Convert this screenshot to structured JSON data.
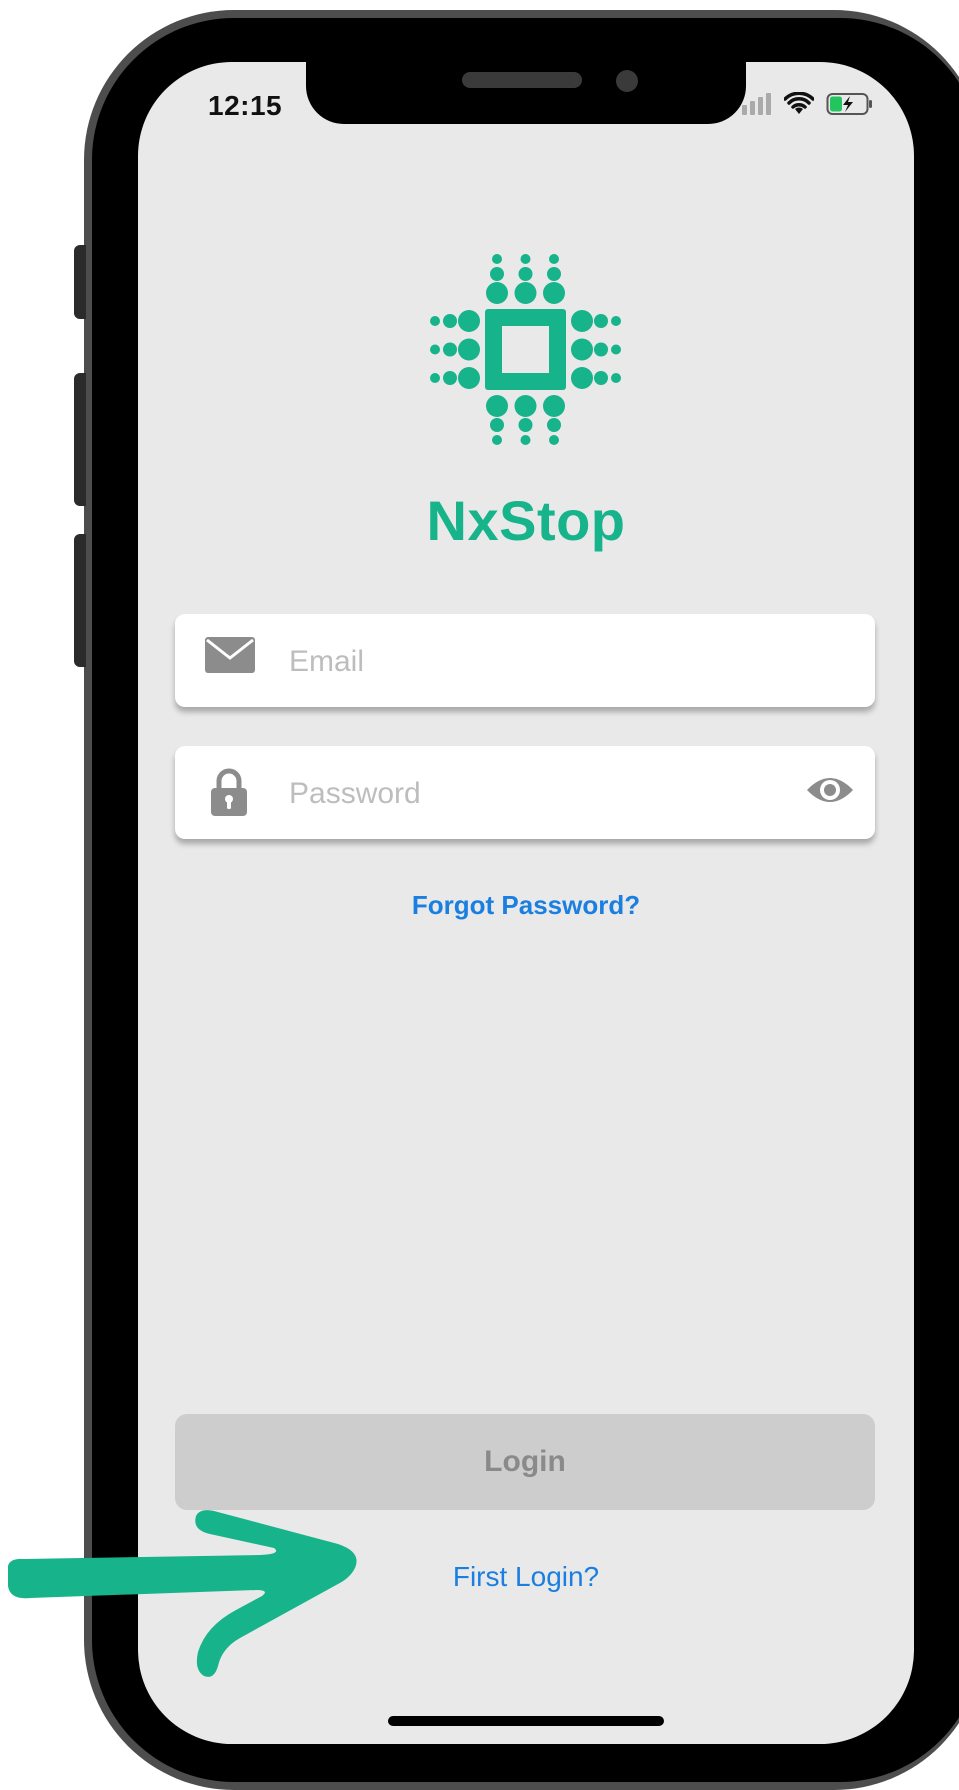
{
  "status_bar": {
    "time": "12:15"
  },
  "app": {
    "name": "NxStop"
  },
  "login_form": {
    "email": {
      "placeholder": "Email",
      "value": ""
    },
    "password": {
      "placeholder": "Password",
      "value": ""
    },
    "forgot_password_label": "Forgot Password?",
    "login_button_label": "Login",
    "first_login_label": "First Login?"
  },
  "icons": [
    "mail-icon",
    "lock-icon",
    "eye-icon",
    "signal-icon",
    "wifi-icon",
    "battery-charging-icon",
    "arrow-pointer-icon"
  ],
  "colors": {
    "brand": "#17b38b",
    "link": "#1a7fe0",
    "disabled_button": "#cdcdcd",
    "screen_bg": "#e9e9e9"
  }
}
